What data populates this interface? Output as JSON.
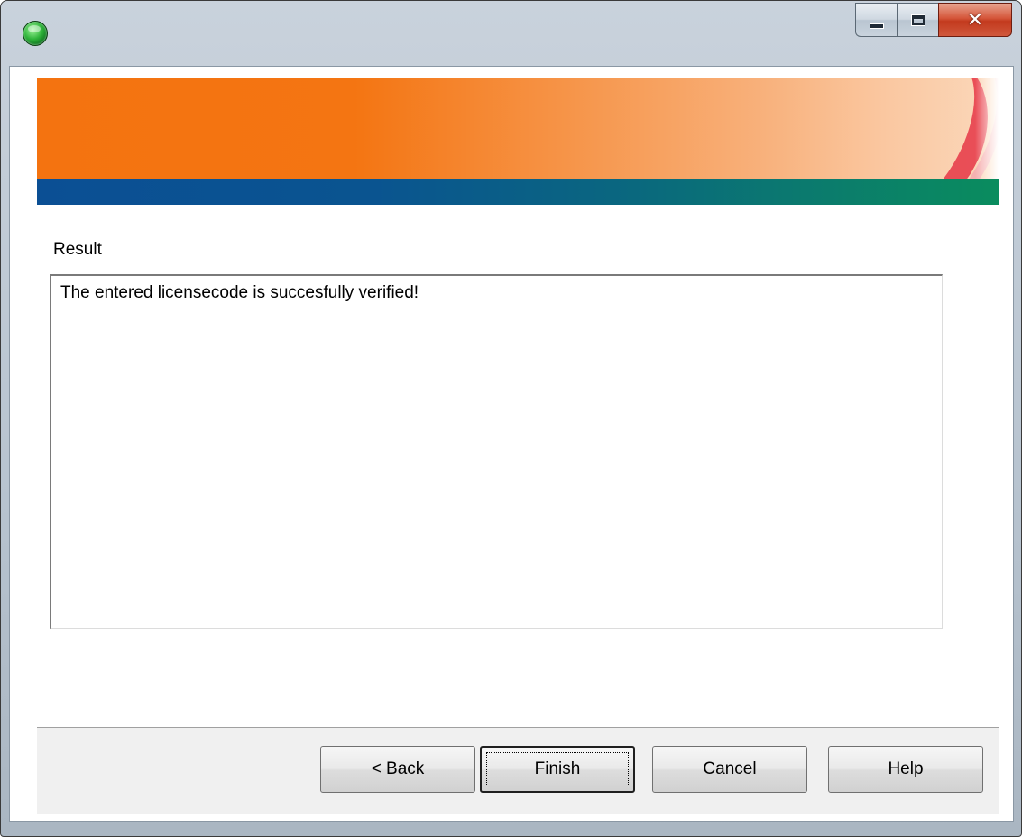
{
  "window": {
    "title": "",
    "controls": {
      "minimize": "minimize-icon",
      "maximize": "maximize-icon",
      "close": "close-icon"
    }
  },
  "banner": {
    "colors": {
      "orange": "#f47310",
      "blue": "#0b4f94",
      "green": "#0a8c5e",
      "swoosh": "#e8404d"
    }
  },
  "result": {
    "label": "Result",
    "text": "The entered licensecode is succesfully verified!"
  },
  "footer": {
    "back_label": "< Back",
    "finish_label": "Finish",
    "cancel_label": "Cancel",
    "help_label": "Help"
  }
}
